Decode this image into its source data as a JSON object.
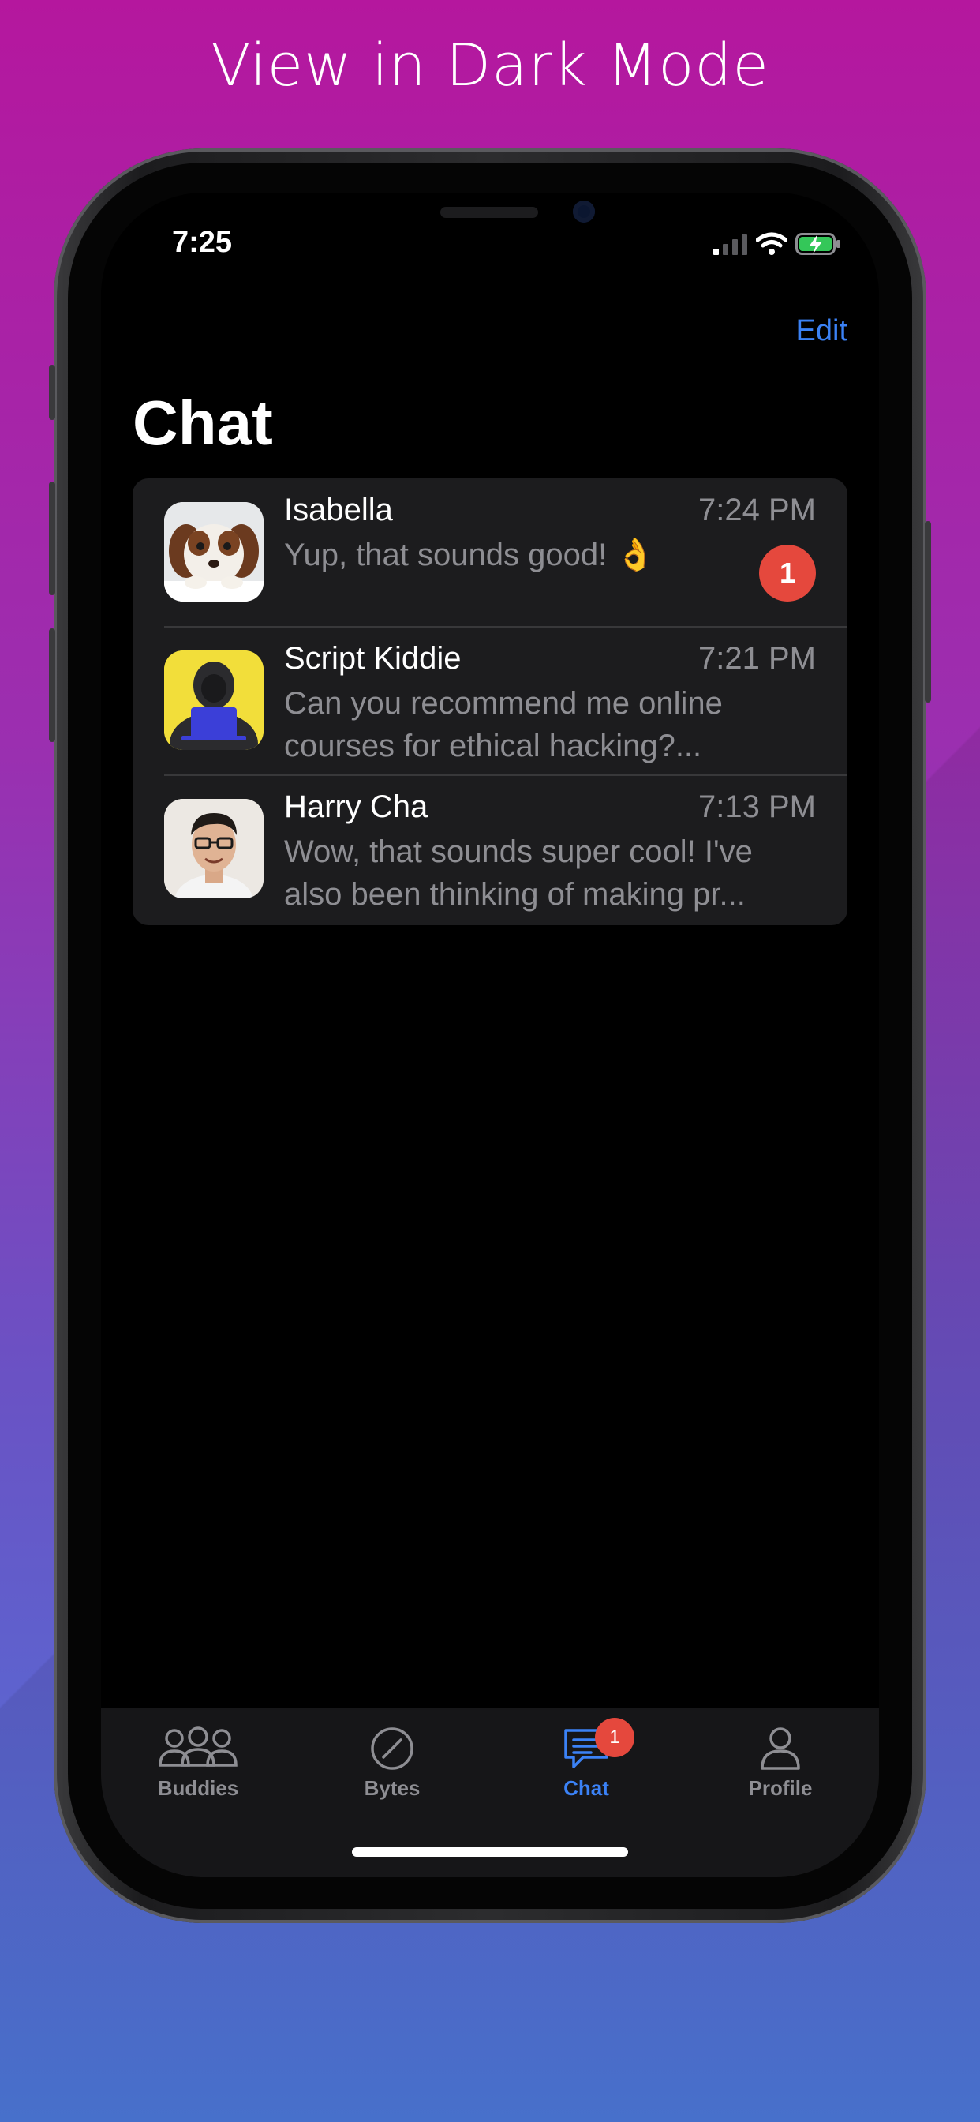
{
  "promo": {
    "headline": "View in Dark Mode"
  },
  "status_bar": {
    "time": "7:25"
  },
  "header": {
    "edit_label": "Edit",
    "title": "Chat"
  },
  "chats": [
    {
      "name": "Isabella",
      "time": "7:24 PM",
      "message": "Yup, that sounds good! 👌",
      "unread": "1",
      "avatar": "puppy-avatar"
    },
    {
      "name": "Script Kiddie",
      "time": "7:21 PM",
      "message": "Can you recommend me online courses for ethical hacking?...",
      "unread": "",
      "avatar": "hacker-avatar"
    },
    {
      "name": "Harry Cha",
      "time": "7:13 PM",
      "message": "Wow, that sounds super cool! I've also been thinking of making pr...",
      "unread": "",
      "avatar": "person-avatar"
    }
  ],
  "tabs": [
    {
      "label": "Buddies",
      "icon": "buddies-icon"
    },
    {
      "label": "Bytes",
      "icon": "compass-icon"
    },
    {
      "label": "Chat",
      "icon": "chat-bubble-icon",
      "badge": "1",
      "active": true
    },
    {
      "label": "Profile",
      "icon": "person-icon"
    }
  ],
  "colors": {
    "accent": "#3b82f6",
    "badge": "#e5483d",
    "background": "#000000",
    "card": "#1c1c1e"
  }
}
